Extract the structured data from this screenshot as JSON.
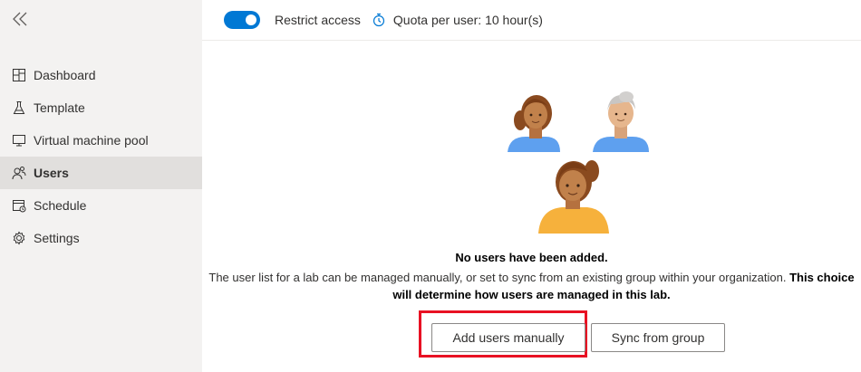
{
  "sidebar": {
    "items": [
      {
        "label": "Dashboard",
        "icon": "dashboard-icon"
      },
      {
        "label": "Template",
        "icon": "flask-icon"
      },
      {
        "label": "Virtual machine pool",
        "icon": "monitor-icon"
      },
      {
        "label": "Users",
        "icon": "users-icon",
        "active": true
      },
      {
        "label": "Schedule",
        "icon": "calendar-icon"
      },
      {
        "label": "Settings",
        "icon": "gear-icon"
      }
    ]
  },
  "topbar": {
    "toggle_on": true,
    "toggle_label": "Restrict access",
    "quota_label": "Quota per user: 10 hour(s)"
  },
  "empty_state": {
    "title": "No users have been added.",
    "description": "The user list for a lab can be managed manually, or set to sync from an existing group within your organization. ",
    "description_bold": "This choice will determine how users are managed in this lab."
  },
  "buttons": {
    "add_users": "Add users manually",
    "sync_group": "Sync from group"
  },
  "colors": {
    "accent": "#0078d4",
    "highlight": "#e81123",
    "sidebar_bg": "#f3f2f1",
    "active_bg": "#e1dfdd"
  }
}
